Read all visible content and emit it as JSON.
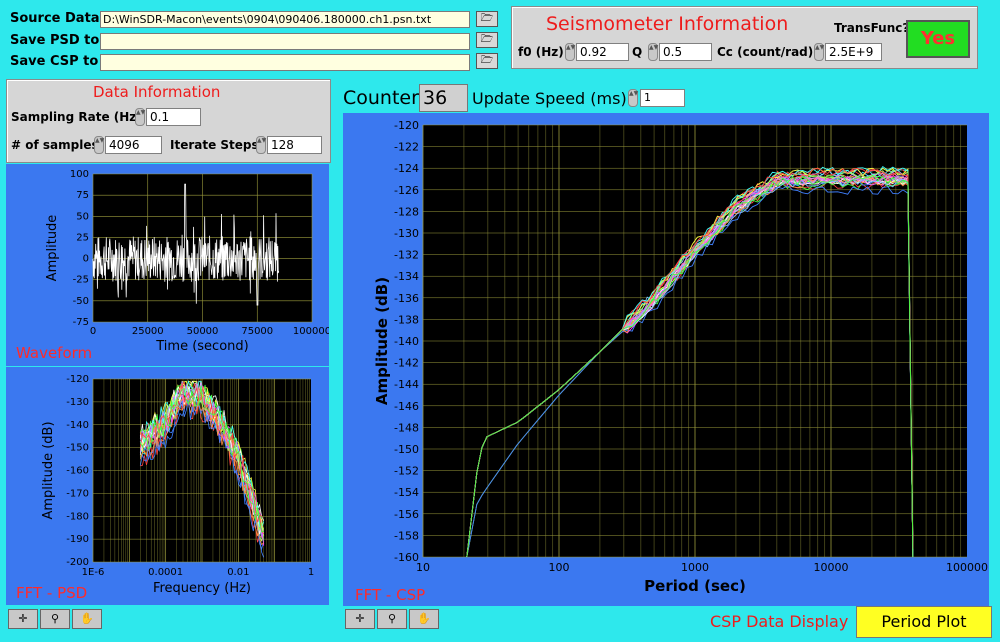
{
  "files": {
    "source": {
      "label": "Source Data",
      "value": "D:\\WinSDR-Macon\\events\\0904\\090406.180000.ch1.psn.txt"
    },
    "psd": {
      "label": "Save PSD to",
      "value": ""
    },
    "csp": {
      "label": "Save CSP to",
      "value": ""
    }
  },
  "seismometer": {
    "title": "Seismometer Information",
    "f0_label": "f0 (Hz)",
    "f0": "0.92",
    "q_label": "Q",
    "q": "0.5",
    "cc_label": "Cc (count/rad)",
    "cc": "2.5E+9",
    "transfunc_label": "TransFunc?",
    "transfunc_button": "Yes"
  },
  "data_info": {
    "title": "Data Information",
    "sampling_label": "Sampling Rate (Hz)",
    "sampling": "0.1",
    "samples_label": "# of samples",
    "samples": "4096",
    "iterate_label": "Iterate Steps",
    "iterate": "128"
  },
  "counter": {
    "label": "Counter",
    "value": "36",
    "speed_label": "Update Speed (ms)",
    "speed": "1"
  },
  "waveform": {
    "caption": "Waveform",
    "xlabel": "Time (second)",
    "ylabel": "Amplitude",
    "yticks": [
      "100",
      "75",
      "50",
      "25",
      "0",
      "-25",
      "-50",
      "-75"
    ],
    "xticks": [
      "0",
      "25000",
      "50000",
      "75000",
      "100000"
    ]
  },
  "psd": {
    "caption": "FFT - PSD",
    "xlabel": "Frequency (Hz)",
    "ylabel": "Amplitude (dB)",
    "yticks": [
      "-120",
      "-130",
      "-140",
      "-150",
      "-160",
      "-170",
      "-180",
      "-190",
      "-200"
    ],
    "xticks": [
      "1E-6",
      "0.0001",
      "0.01",
      "1"
    ]
  },
  "csp": {
    "caption": "FFT - CSP",
    "xlabel": "Period (sec)",
    "ylabel": "Amplitude (dB)",
    "yticks": [
      "-120",
      "-122",
      "-124",
      "-126",
      "-128",
      "-130",
      "-132",
      "-134",
      "-136",
      "-138",
      "-140",
      "-142",
      "-144",
      "-146",
      "-148",
      "-150",
      "-152",
      "-154",
      "-156",
      "-158",
      "-160"
    ],
    "xticks": [
      "10",
      "100",
      "1000",
      "10000",
      "100000"
    ]
  },
  "display": {
    "label": "CSP Data Display",
    "button": "Period Plot"
  },
  "colors": {
    "plot_bg": "#000000",
    "grid": "#9c9c3c",
    "caption": "#ff2a2a",
    "yes_bg": "#22dd22",
    "yes_text": "#ff3030",
    "period_bg": "#ffff22"
  },
  "chart_data": [
    {
      "type": "line",
      "title": "Waveform",
      "xlabel": "Time (second)",
      "ylabel": "Amplitude",
      "xlim": [
        0,
        100000
      ],
      "ylim": [
        -75,
        100
      ],
      "series": [
        {
          "x": [
            0,
            10000,
            20000,
            30000,
            40000,
            42000,
            50000,
            60000,
            70000,
            75000,
            80000,
            85000
          ],
          "values": [
            5,
            -10,
            20,
            -15,
            10,
            85,
            -20,
            15,
            -30,
            10,
            40,
            0
          ]
        }
      ]
    },
    {
      "type": "line",
      "title": "FFT - PSD",
      "xlabel": "Frequency (Hz)",
      "ylabel": "Amplitude (dB)",
      "xscale": "log",
      "xlim": [
        1e-06,
        1
      ],
      "ylim": [
        -200,
        -120
      ],
      "series": [
        {
          "x": [
            2e-05,
            0.0001,
            0.0003,
            0.001,
            0.003,
            0.01,
            0.05
          ],
          "values": [
            -150,
            -140,
            -127,
            -128,
            -140,
            -155,
            -190
          ]
        }
      ]
    },
    {
      "type": "line",
      "title": "FFT - CSP",
      "xlabel": "Period (sec)",
      "ylabel": "Amplitude (dB)",
      "xscale": "log",
      "xlim": [
        10,
        100000
      ],
      "ylim": [
        -160,
        -120
      ],
      "series": [
        {
          "x": [
            21,
            25,
            28,
            50,
            100,
            200,
            500,
            1000,
            2000,
            4000,
            10000,
            40000
          ],
          "values": [
            -160,
            -152,
            -149,
            -147.5,
            -144.5,
            -141,
            -136,
            -131.5,
            -127.5,
            -125,
            -124.8,
            -124.8
          ]
        },
        {
          "x": [
            21,
            25,
            28,
            50,
            100,
            200,
            500,
            1000,
            2000,
            4000,
            10000,
            40000
          ],
          "values": [
            -160,
            -155,
            -154,
            -149.5,
            -145,
            -141,
            -136.5,
            -132,
            -128,
            -125.5,
            -125.5,
            -125.5
          ]
        }
      ]
    }
  ]
}
